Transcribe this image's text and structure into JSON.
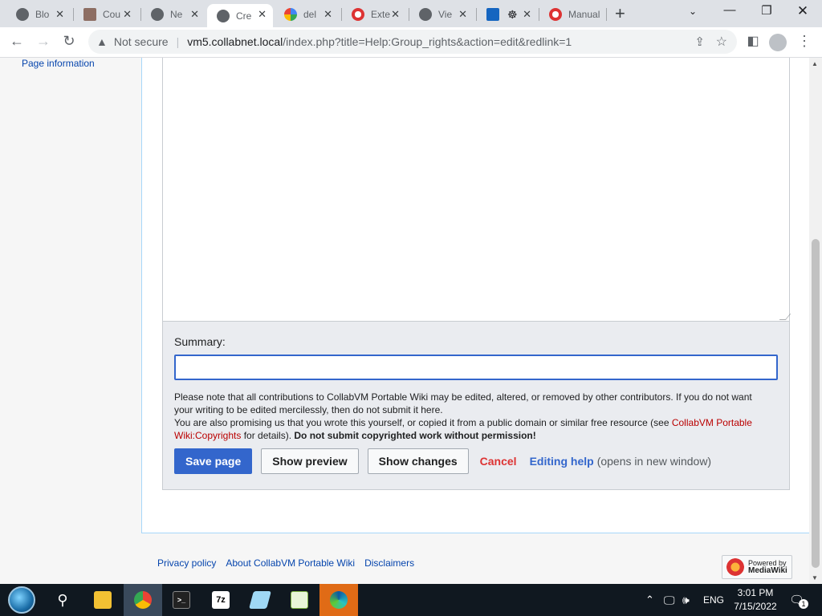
{
  "browser": {
    "tabs": [
      {
        "title": "Blo",
        "active": false,
        "favicon_color": "#5f6368"
      },
      {
        "title": "Cou",
        "active": false,
        "favicon_color": "#8d6e63"
      },
      {
        "title": "Ne",
        "active": false,
        "favicon_color": "#5f6368"
      },
      {
        "title": "Cre",
        "active": true,
        "favicon_color": "#5f6368"
      },
      {
        "title": "del",
        "active": false,
        "favicon_color": "#4285f4"
      },
      {
        "title": "Exte",
        "active": false,
        "favicon_color": "#d33"
      },
      {
        "title": "Vie",
        "active": false,
        "favicon_color": "#5f6368"
      },
      {
        "title": "",
        "active": false,
        "favicon_color": "#1565c0"
      },
      {
        "title": "Manual",
        "active": false,
        "favicon_color": "#d33"
      }
    ],
    "new_tab_symbol": "+",
    "security_label": "Not secure",
    "url_host": "vm5.collabnet.local",
    "url_path": "/index.php?title=Help:Group_rights&action=edit&redlink=1"
  },
  "sidebar": {
    "page_information": "Page information"
  },
  "editor": {
    "summary_label": "Summary:",
    "summary_value": "",
    "notice_line1": "Please note that all contributions to CollabVM Portable Wiki may be edited, altered, or removed by other contributors. If you do not want your writing to be edited mercilessly, then do not submit it here.",
    "notice_line2_prefix": "You are also promising us that you wrote this yourself, or copied it from a public domain or similar free resource (see ",
    "notice_link": "CollabVM Portable Wiki:Copyrights",
    "notice_line2_suffix": " for details). ",
    "notice_bold": "Do not submit copyrighted work without permission!",
    "buttons": {
      "save": "Save page",
      "preview": "Show preview",
      "changes": "Show changes",
      "cancel": "Cancel",
      "editing_help": "Editing help",
      "editing_help_note": "(opens in new window)"
    }
  },
  "footer": {
    "links": [
      "Privacy policy",
      "About CollabVM Portable Wiki",
      "Disclaimers"
    ],
    "powered_line1": "Powered by",
    "powered_line2": "MediaWiki"
  },
  "taskbar": {
    "apps": [
      "start",
      "search",
      "file-explorer",
      "chrome",
      "terminal",
      "7zip",
      "notepad",
      "notepad-plus",
      "edge"
    ],
    "language": "ENG",
    "time": "3:01 PM",
    "date": "7/15/2022",
    "notification_count": "1"
  }
}
